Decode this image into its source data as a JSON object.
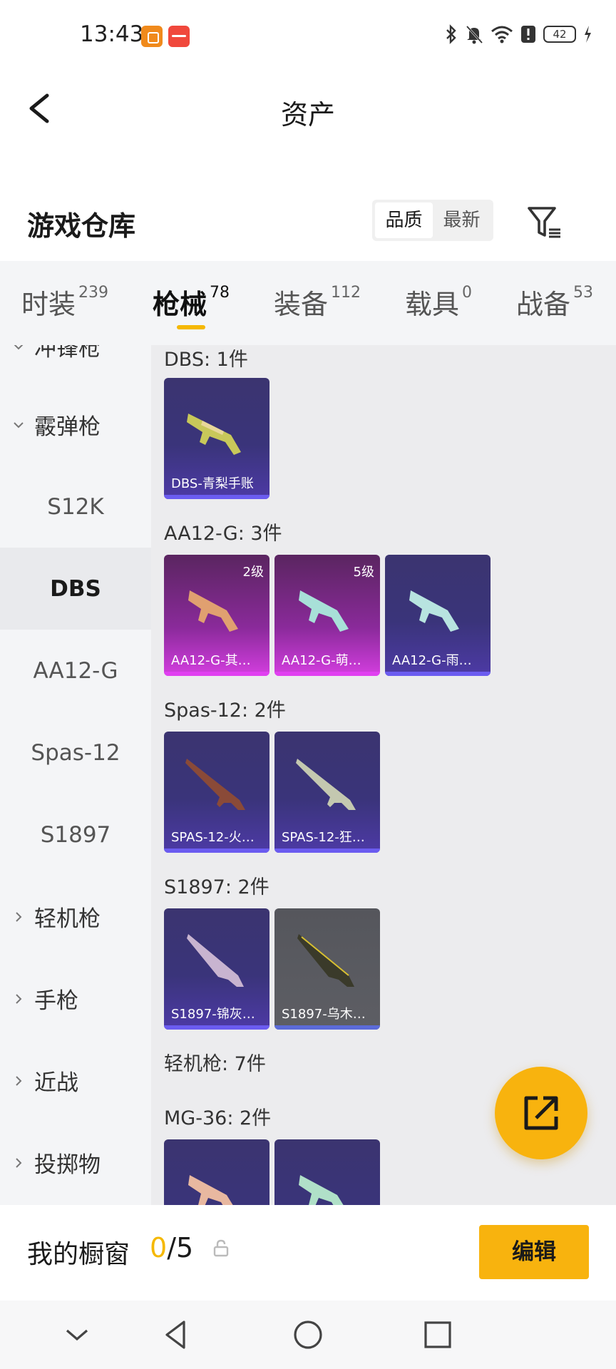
{
  "status_bar": {
    "time": "13:43",
    "battery": "42",
    "icons": [
      "app-notification-icon",
      "app-notification-icon",
      "bluetooth-icon",
      "mute-icon",
      "wifi-icon",
      "alert-icon",
      "battery-icon",
      "charging-icon"
    ]
  },
  "header": {
    "title": "资产"
  },
  "warehouse": {
    "title": "游戏仓库",
    "sort_options": [
      "品质",
      "最新"
    ],
    "sort_selected": "品质"
  },
  "tabs": [
    {
      "label": "时装",
      "count": "239"
    },
    {
      "label": "枪械",
      "count": "78",
      "active": true
    },
    {
      "label": "装备",
      "count": "112"
    },
    {
      "label": "载具",
      "count": "0"
    },
    {
      "label": "战备",
      "count": "53"
    }
  ],
  "sidebar": {
    "partial_top": "冲锋枪",
    "shotgun": "霰弹枪",
    "s12k": "S12K",
    "dbs": "DBS",
    "aa12g": "AA12-G",
    "spas12": "Spas-12",
    "s1897": "S1897",
    "lmg": "轻机枪",
    "pistol": "手枪",
    "melee": "近战",
    "throwable": "投掷物"
  },
  "sections": {
    "dbs": {
      "label": "DBS: 1件",
      "items": [
        {
          "name": "DBS-青梨手账"
        }
      ]
    },
    "aa12g": {
      "label": "AA12-G: 3件",
      "items": [
        {
          "name": "AA12-G-其…",
          "level": "2级"
        },
        {
          "name": "AA12-G-萌…",
          "level": "5级"
        },
        {
          "name": "AA12-G-雨…"
        }
      ]
    },
    "spas12": {
      "label": "Spas-12: 2件",
      "items": [
        {
          "name": "SPAS-12-火…"
        },
        {
          "name": "SPAS-12-狂…"
        }
      ]
    },
    "s1897": {
      "label": "S1897: 2件",
      "items": [
        {
          "name": "S1897-锦灰…"
        },
        {
          "name": "S1897-乌木…"
        }
      ]
    },
    "lmg": {
      "label": "轻机枪: 7件"
    },
    "mg36": {
      "label": "MG-36: 2件"
    }
  },
  "showcase": {
    "label": "我的橱窗",
    "current": "0",
    "total": "/5",
    "edit_label": "编辑"
  },
  "colors": {
    "accent": "#f8b30e",
    "card_purple": "#3a347a",
    "card_pink": "#d43ee0",
    "card_gray": "#5d5e64"
  }
}
